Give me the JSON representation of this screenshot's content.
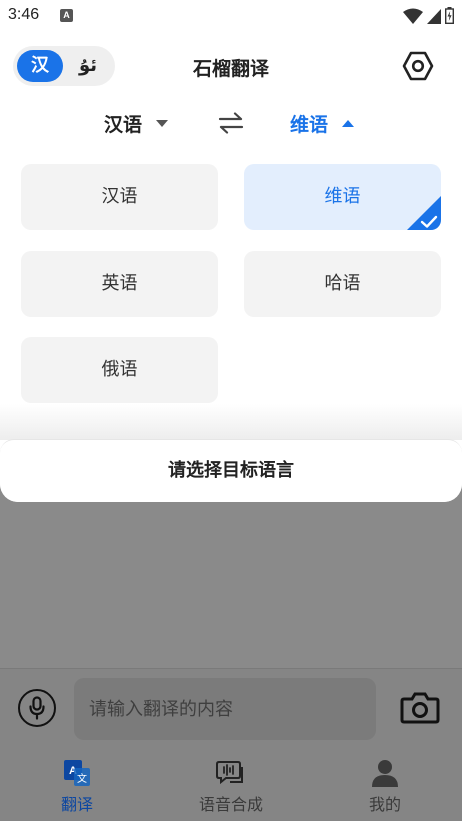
{
  "status_bar": {
    "time": "3:46",
    "notification_letter": "A"
  },
  "header": {
    "title": "石榴翻译",
    "toggle": {
      "active_label": "汉",
      "inactive_label": "ئۇ"
    }
  },
  "lang_bar": {
    "source": "汉语",
    "target": "维语"
  },
  "language_options": [
    {
      "label": "汉语",
      "selected": false
    },
    {
      "label": "维语",
      "selected": true
    },
    {
      "label": "英语",
      "selected": false
    },
    {
      "label": "哈语",
      "selected": false
    },
    {
      "label": "俄语",
      "selected": false
    }
  ],
  "sheet_footer": {
    "label": "请选择目标语言"
  },
  "input": {
    "placeholder": "请输入翻译的内容",
    "value": ""
  },
  "tabs": [
    {
      "label": "翻译",
      "icon": "translate-icon",
      "active": true
    },
    {
      "label": "语音合成",
      "icon": "voice-chat-icon",
      "active": false
    },
    {
      "label": "我的",
      "icon": "person-icon",
      "active": false
    }
  ],
  "colors": {
    "accent": "#1a73e8",
    "tab_active": "#0d47a1",
    "dim_overlay": "#858585"
  }
}
